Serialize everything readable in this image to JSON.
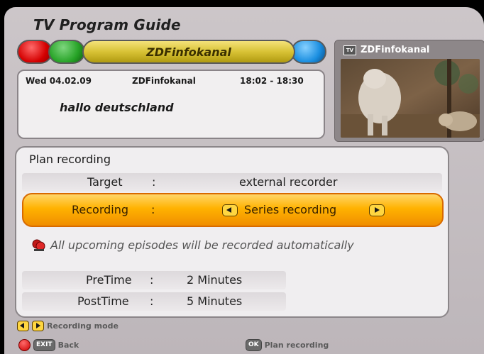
{
  "header": {
    "title": "TV Program Guide"
  },
  "channel_bar": {
    "channel": "ZDFinfokanal"
  },
  "program_info": {
    "date": "Wed 04.02.09",
    "channel": "ZDFinfokanal",
    "time": "18:02 - 18:30",
    "title": "hallo deutschland"
  },
  "preview": {
    "badge": "TV",
    "channel": "ZDFinfokanal"
  },
  "plan_recording": {
    "title": "Plan recording",
    "target": {
      "label": "Target",
      "separator": ":",
      "value": "external recorder"
    },
    "recording": {
      "label": "Recording",
      "separator": ":",
      "value": "Series recording"
    },
    "notice": "All upcoming episodes will be recorded automatically",
    "pretime": {
      "label": "PreTime",
      "separator": ":",
      "value": "2 Minutes"
    },
    "posttime": {
      "label": "PostTime",
      "separator": ":",
      "value": "5 Minutes"
    }
  },
  "footer": {
    "mode_label": "Recording mode",
    "exit_key": "EXIT",
    "back_label": "Back",
    "ok_key": "OK",
    "plan_label": "Plan recording"
  },
  "colors": {
    "panel": "#c6c0c3",
    "highlight": "#ffb200",
    "red_key": "#d40000",
    "green_key": "#27a327",
    "yellow_key": "#d8c235",
    "blue_key": "#1a8ee0"
  }
}
